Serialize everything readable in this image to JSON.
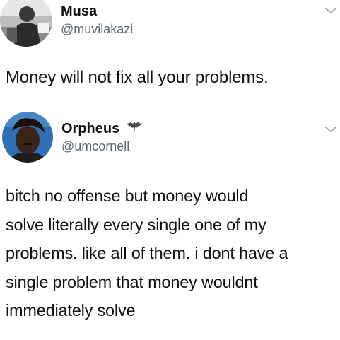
{
  "tweets": [
    {
      "author": {
        "name": "Musa",
        "handle": "@muvilakazi",
        "avatar_icon": "profile-photo"
      },
      "menu_icon": "chevron-down-icon",
      "text": "Money will not fix all your problems."
    },
    {
      "author": {
        "name": "Orpheus",
        "name_emoji_icon": "bat-icon",
        "handle": "@umcornell",
        "avatar_icon": "profile-photo"
      },
      "menu_icon": "chevron-down-icon",
      "text_lines": [
        "bitch no offense but money would",
        "solve literally every single one of my",
        "problems. like all of them. i dont have a",
        "single problem that money wouldnt",
        "immediately solve"
      ]
    }
  ]
}
